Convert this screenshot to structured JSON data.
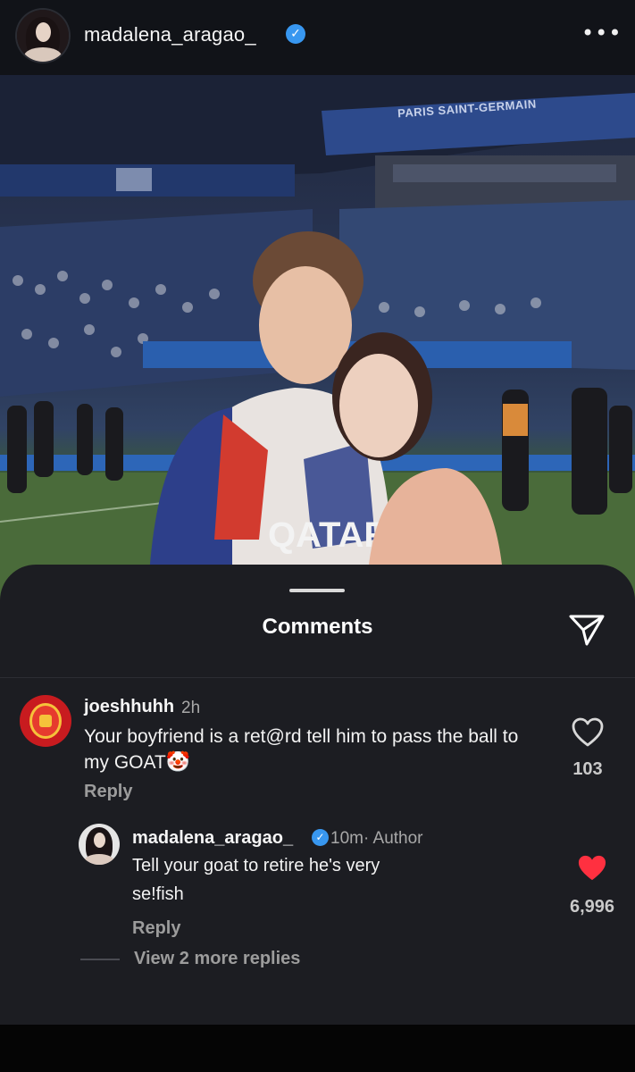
{
  "header": {
    "username": "madalena_aragao_",
    "verified_icon": "verified-badge-icon",
    "more_icon": "more-horizontal-icon"
  },
  "photo": {
    "stadium_banner": "PARIS SAINT-GERMAIN",
    "shirt_text": "QATAR"
  },
  "comments_sheet": {
    "title": "Comments",
    "send_icon": "send-paper-plane-icon",
    "comment": {
      "username": "joeshhuhh",
      "time": "2h",
      "text": "Your boyfriend is a ret@rd tell him to pass the ball to my GOAT",
      "emoji": "🤡",
      "reply_label": "Reply",
      "like_count": "103",
      "liked": false
    },
    "reply": {
      "username": "madalena_aragao_",
      "meta": "10m· Author",
      "text_line1": "Tell your goat to retire he's very",
      "text_line2": "se!fish",
      "reply_label": "Reply",
      "like_count": "6,996",
      "liked": true
    },
    "view_more_replies": "View 2 more replies"
  },
  "colors": {
    "sheet_bg": "#1c1d22",
    "page_bg": "#111318",
    "verified_blue": "#3897f0",
    "liked_red": "#ff3040",
    "muted_text": "#9c9c9c"
  }
}
